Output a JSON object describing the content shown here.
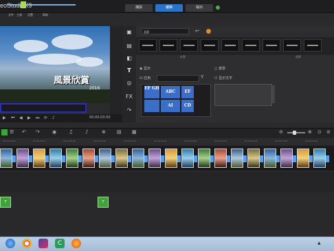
{
  "titlebar": {
    "app_title": "eoStudioX9",
    "menu": [
      "文件",
      "工具",
      "设置",
      "帮助"
    ],
    "tabs": [
      "捕获",
      "编辑",
      "输出"
    ],
    "active_tab": "编辑"
  },
  "preview": {
    "caption": "風景欣賞",
    "caption_year": "2016",
    "timecode": "00:00:03:00"
  },
  "library": {
    "dropdown": "画廊",
    "sections": [
      "标题",
      "画廊"
    ],
    "options": [
      "显示",
      "遮罩",
      "应用",
      "显示文字"
    ],
    "styles": [
      "EF GH",
      "ABC",
      "EF",
      "AI",
      "CD"
    ]
  },
  "timeline": {
    "ruler_labels": [
      "00:00:00:00",
      "00:00:03:00",
      "00:00:06:00",
      "00:00:09:00",
      "00:00:12:00",
      "00:00:15:00",
      "00:00:18:00",
      "00:00:21:00",
      "00:00:24:00",
      "00:00:27:00",
      "00:00:30:00"
    ],
    "green_clip_label": "T"
  },
  "colors": {
    "accent": "#2a73c6",
    "trim_border": "#2a2ad0",
    "clip_green": "#3fa23a"
  }
}
